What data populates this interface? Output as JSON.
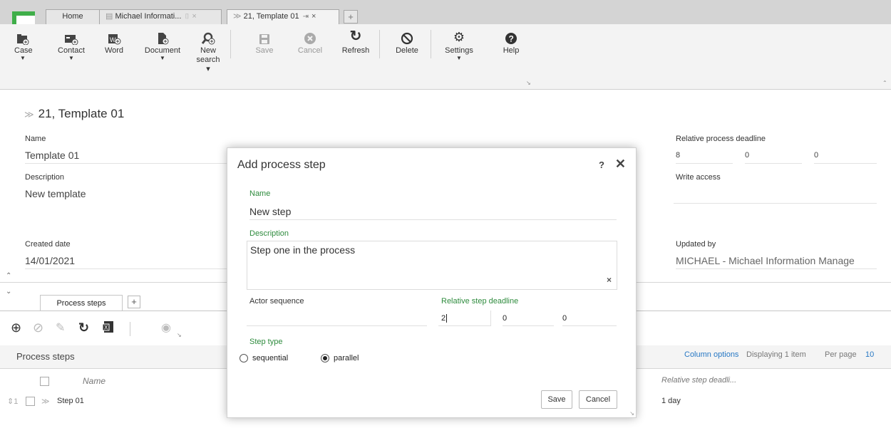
{
  "tabs": [
    {
      "label": "Home"
    },
    {
      "label": "Michael Informati...",
      "pin": "⌷",
      "close": "×"
    },
    {
      "label": "21, Template 01",
      "pin": "⇥",
      "close": "×"
    }
  ],
  "new_tab": "+",
  "ribbon": {
    "case": "Case",
    "contact": "Contact",
    "word": "Word",
    "document": "Document",
    "new_search_1": "New",
    "new_search_2": "search ▾",
    "save": "Save",
    "cancel": "Cancel",
    "refresh": "Refresh",
    "delete": "Delete",
    "settings": "Settings",
    "help": "Help",
    "dropdown_arrow": "▼"
  },
  "record": {
    "title": "21, Template 01",
    "name_label": "Name",
    "name_value": "Template 01",
    "description_label": "Description",
    "description_value": "New template",
    "created_label": "Created date",
    "created_value": "14/01/2021",
    "relative_deadline_label": "Relative process deadline",
    "relative_deadline_values": [
      "8",
      "0",
      "0"
    ],
    "write_access_label": "Write access",
    "updated_label": "Updated by",
    "updated_value": "MICHAEL - Michael Information Manage"
  },
  "process_steps": {
    "tab_label": "Process steps",
    "add_tab": "+",
    "grid_title": "Process steps",
    "column_options": "Column options",
    "displaying": "Displaying 1 item",
    "per_page_label": "Per page",
    "per_page_value": "10",
    "col_name": "Name",
    "col_deadline": "Relative step deadli...",
    "rows": [
      {
        "order": "1",
        "name": "Step 01",
        "deadline": "1 day"
      }
    ]
  },
  "modal": {
    "title": "Add process step",
    "help": "?",
    "close": "✕",
    "name_label": "Name",
    "name_value": "New step",
    "description_label": "Description",
    "description_value": "Step one in the process",
    "clear": "×",
    "actor_label": "Actor sequence",
    "deadline_label": "Relative step deadline",
    "deadline_values": [
      "2",
      "0",
      "0"
    ],
    "step_type_label": "Step type",
    "option_sequential": "sequential",
    "option_parallel": "parallel",
    "selected_type": "parallel",
    "save": "Save",
    "cancel": "Cancel"
  },
  "colors": {
    "accent_green": "#3fae49",
    "required_green": "#2e8b3d",
    "link_blue": "#2778c4"
  }
}
